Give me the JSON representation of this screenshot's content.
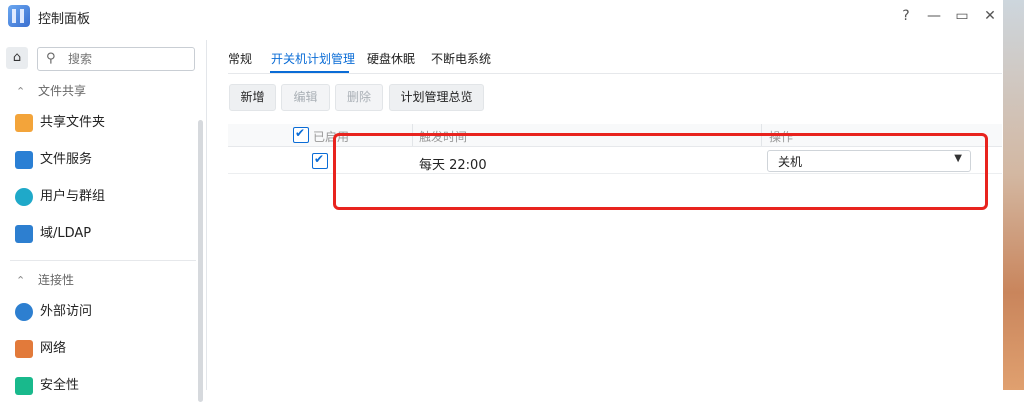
{
  "window": {
    "title": "控制面板",
    "controls": {
      "help": "?",
      "minimize": "—",
      "maximize": "▭",
      "close": "✕"
    }
  },
  "sidebar": {
    "search": {
      "placeholder": "搜索",
      "value": ""
    },
    "sections": [
      {
        "label": "文件共享",
        "items": [
          {
            "label": "共享文件夹",
            "icon": "folder-icon",
            "color": "#f3a43a"
          },
          {
            "label": "文件服务",
            "icon": "file-services-icon",
            "color": "#2a7fd4"
          },
          {
            "label": "用户与群组",
            "icon": "users-icon",
            "color": "#1fa9c9"
          },
          {
            "label": "域/LDAP",
            "icon": "ldap-icon",
            "color": "#2d7fd0"
          }
        ]
      },
      {
        "label": "连接性",
        "items": [
          {
            "label": "外部访问",
            "icon": "external-access-icon",
            "color": "#2d7fd0"
          },
          {
            "label": "网络",
            "icon": "network-icon",
            "color": "#e27a3a"
          },
          {
            "label": "安全性",
            "icon": "security-icon",
            "color": "#19b98c"
          }
        ]
      }
    ]
  },
  "tabs": [
    {
      "label": "常规",
      "active": false
    },
    {
      "label": "开关机计划管理",
      "active": true
    },
    {
      "label": "硬盘休眠",
      "active": false
    },
    {
      "label": "不断电系统",
      "active": false
    }
  ],
  "toolbar": {
    "add": "新增",
    "edit": "编辑",
    "delete": "删除",
    "overview": "计划管理总览"
  },
  "table": {
    "columns": {
      "enabled": "已启用",
      "time": "触发时间",
      "action": "操作"
    },
    "rows": [
      {
        "enabled": true,
        "time": "每天 22:00",
        "action": "关机"
      }
    ]
  },
  "colors": {
    "accent": "#0a6cd6",
    "highlight": "#e8231e"
  }
}
